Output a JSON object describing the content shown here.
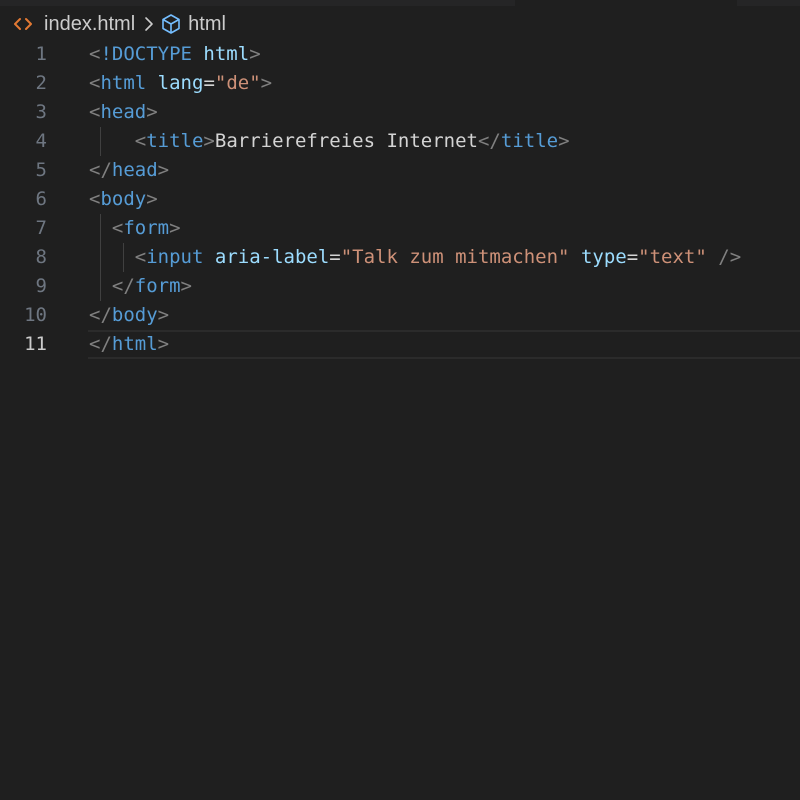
{
  "breadcrumb": {
    "file": "index.html",
    "file_icon": "html-file-icon",
    "separator_icon": "chevron-right-icon",
    "symbol": "html",
    "symbol_icon": "cube-icon"
  },
  "editor": {
    "current_line": 11,
    "lines": [
      {
        "n": "1",
        "tokens": [
          [
            "p",
            "<"
          ],
          [
            "t",
            "!DOCTYPE"
          ],
          [
            "x",
            " "
          ],
          [
            "a",
            "html"
          ],
          [
            "p",
            ">"
          ]
        ]
      },
      {
        "n": "2",
        "tokens": [
          [
            "p",
            "<"
          ],
          [
            "t",
            "html"
          ],
          [
            "x",
            " "
          ],
          [
            "a",
            "lang"
          ],
          [
            "x",
            "="
          ],
          [
            "s",
            "\"de\""
          ],
          [
            "p",
            ">"
          ]
        ]
      },
      {
        "n": "3",
        "tokens": [
          [
            "p",
            "<"
          ],
          [
            "t",
            "head"
          ],
          [
            "p",
            ">"
          ]
        ]
      },
      {
        "n": "4",
        "tokens": [
          [
            "x",
            "    "
          ],
          [
            "p",
            "<"
          ],
          [
            "t",
            "title"
          ],
          [
            "p",
            ">"
          ],
          [
            "x",
            "Barrierefreies Internet"
          ],
          [
            "p",
            "</"
          ],
          [
            "t",
            "title"
          ],
          [
            "p",
            ">"
          ]
        ]
      },
      {
        "n": "5",
        "tokens": [
          [
            "p",
            "</"
          ],
          [
            "t",
            "head"
          ],
          [
            "p",
            ">"
          ]
        ]
      },
      {
        "n": "6",
        "tokens": [
          [
            "p",
            "<"
          ],
          [
            "t",
            "body"
          ],
          [
            "p",
            ">"
          ]
        ]
      },
      {
        "n": "7",
        "tokens": [
          [
            "x",
            "  "
          ],
          [
            "p",
            "<"
          ],
          [
            "t",
            "form"
          ],
          [
            "p",
            ">"
          ]
        ]
      },
      {
        "n": "8",
        "tokens": [
          [
            "x",
            "    "
          ],
          [
            "p",
            "<"
          ],
          [
            "t",
            "input"
          ],
          [
            "x",
            " "
          ],
          [
            "a",
            "aria-label"
          ],
          [
            "x",
            "="
          ],
          [
            "s",
            "\"Talk zum mitmachen\""
          ],
          [
            "x",
            " "
          ],
          [
            "a",
            "type"
          ],
          [
            "x",
            "="
          ],
          [
            "s",
            "\"text\""
          ],
          [
            "x",
            " "
          ],
          [
            "p",
            "/>"
          ]
        ]
      },
      {
        "n": "9",
        "tokens": [
          [
            "x",
            "  "
          ],
          [
            "p",
            "</"
          ],
          [
            "t",
            "form"
          ],
          [
            "p",
            ">"
          ]
        ]
      },
      {
        "n": "10",
        "tokens": [
          [
            "p",
            "</"
          ],
          [
            "t",
            "body"
          ],
          [
            "p",
            ">"
          ]
        ]
      },
      {
        "n": "11",
        "tokens": [
          [
            "p",
            "</"
          ],
          [
            "t",
            "html"
          ],
          [
            "p",
            ">"
          ]
        ]
      }
    ]
  }
}
